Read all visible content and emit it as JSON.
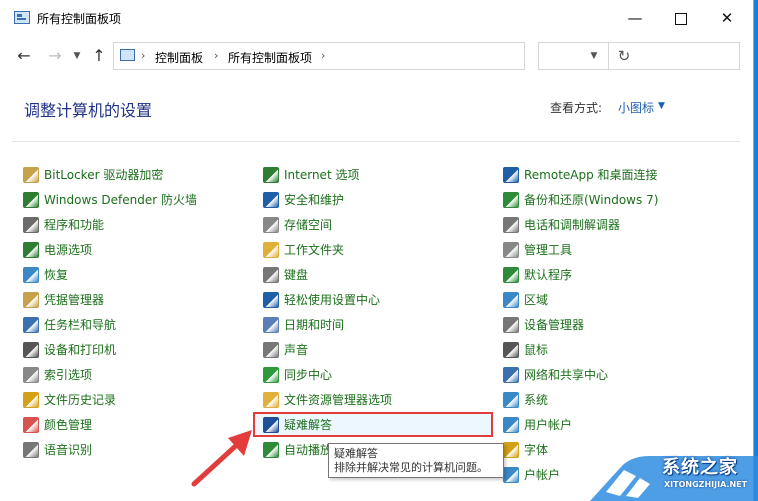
{
  "window": {
    "title": "所有控制面板项"
  },
  "address": {
    "segments": [
      "控制面板",
      "所有控制面板项"
    ]
  },
  "header": {
    "title": "调整计算机的设置",
    "view_label": "查看方式:",
    "view_value": "小图标"
  },
  "columns": [
    [
      {
        "label": "BitLocker 驱动器加密",
        "icon": "bitlocker-icon",
        "color": "#c8a24a"
      },
      {
        "label": "Windows Defender 防火墙",
        "icon": "firewall-icon",
        "color": "#2f7d32"
      },
      {
        "label": "程序和功能",
        "icon": "programs-icon",
        "color": "#6b6b6b"
      },
      {
        "label": "电源选项",
        "icon": "power-icon",
        "color": "#2f7d32"
      },
      {
        "label": "恢复",
        "icon": "recovery-icon",
        "color": "#3a88c8"
      },
      {
        "label": "凭据管理器",
        "icon": "credential-icon",
        "color": "#c8a24a"
      },
      {
        "label": "任务栏和导航",
        "icon": "taskbar-icon",
        "color": "#3a6fb0"
      },
      {
        "label": "设备和打印机",
        "icon": "printer-icon",
        "color": "#555555"
      },
      {
        "label": "索引选项",
        "icon": "index-icon",
        "color": "#888888"
      },
      {
        "label": "文件历史记录",
        "icon": "file-history-icon",
        "color": "#d4a017"
      },
      {
        "label": "颜色管理",
        "icon": "color-management-icon",
        "color": "#d9534f"
      },
      {
        "label": "语音识别",
        "icon": "microphone-icon",
        "color": "#777777"
      }
    ],
    [
      {
        "label": "Internet 选项",
        "icon": "internet-icon",
        "color": "#2f7d32"
      },
      {
        "label": "安全和维护",
        "icon": "flag-icon",
        "color": "#1f5fa8"
      },
      {
        "label": "存储空间",
        "icon": "storage-icon",
        "color": "#888888"
      },
      {
        "label": "工作文件夹",
        "icon": "work-folder-icon",
        "color": "#e0b03a"
      },
      {
        "label": "键盘",
        "icon": "keyboard-icon",
        "color": "#777777"
      },
      {
        "label": "轻松使用设置中心",
        "icon": "ease-of-access-icon",
        "color": "#1f5fa8"
      },
      {
        "label": "日期和时间",
        "icon": "calendar-icon",
        "color": "#5a7fb8"
      },
      {
        "label": "声音",
        "icon": "speaker-icon",
        "color": "#777777"
      },
      {
        "label": "同步中心",
        "icon": "sync-icon",
        "color": "#2e9a3a"
      },
      {
        "label": "文件资源管理器选项",
        "icon": "folder-options-icon",
        "color": "#e0b03a"
      },
      {
        "label": "疑难解答",
        "icon": "troubleshoot-icon",
        "color": "#1f4f9a"
      },
      {
        "label": "自动播放",
        "icon": "autoplay-icon",
        "color": "#2e8b3a"
      }
    ],
    [
      {
        "label": "RemoteApp 和桌面连接",
        "icon": "remoteapp-icon",
        "color": "#1f5fa8"
      },
      {
        "label": "备份和还原(Windows 7)",
        "icon": "backup-icon",
        "color": "#2e8b3a"
      },
      {
        "label": "电话和调制解调器",
        "icon": "phone-icon",
        "color": "#777777"
      },
      {
        "label": "管理工具",
        "icon": "admin-tools-icon",
        "color": "#888888"
      },
      {
        "label": "默认程序",
        "icon": "default-programs-icon",
        "color": "#2e8b3a"
      },
      {
        "label": "区域",
        "icon": "region-icon",
        "color": "#3a88c8"
      },
      {
        "label": "设备管理器",
        "icon": "device-manager-icon",
        "color": "#777777"
      },
      {
        "label": "鼠标",
        "icon": "mouse-icon",
        "color": "#555555"
      },
      {
        "label": "网络和共享中心",
        "icon": "network-icon",
        "color": "#3a6fb0"
      },
      {
        "label": "系统",
        "icon": "system-icon",
        "color": "#3a88c8"
      },
      {
        "label": "用户帐户",
        "icon": "user-accounts-icon",
        "color": "#3a88c8"
      },
      {
        "label": "字体",
        "icon": "fonts-icon",
        "color": "#d4a017"
      },
      {
        "label": "户帐户",
        "icon": "user-accounts-icon",
        "color": "#3a88c8"
      }
    ]
  ],
  "tooltip": {
    "title": "疑难解答",
    "text": "排除并解决常见的计算机问题。"
  },
  "watermark": {
    "cn": "系统之家",
    "en": "XITONGZHIJIA.NET"
  },
  "colors": {
    "link": "#1b6f1b",
    "title": "#1e3287",
    "highlight_border": "#e33c3c",
    "arrow": "#e33c3c"
  }
}
